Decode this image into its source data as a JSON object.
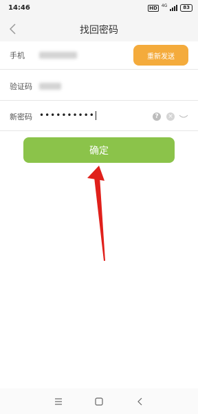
{
  "status_bar": {
    "time": "14:46",
    "hd": "HD",
    "network": "4G",
    "battery": "83"
  },
  "header": {
    "title": "找回密码"
  },
  "form": {
    "phone_label": "手机",
    "resend_label": "重新发送",
    "code_label": "验证码",
    "password_label": "新密码",
    "password_value": "••••••••••",
    "help_symbol": "?",
    "clear_symbol": "×"
  },
  "confirm_label": "确定",
  "colors": {
    "resend": "#f4ab3c",
    "confirm": "#8bc34a",
    "arrow": "#e0201b"
  }
}
